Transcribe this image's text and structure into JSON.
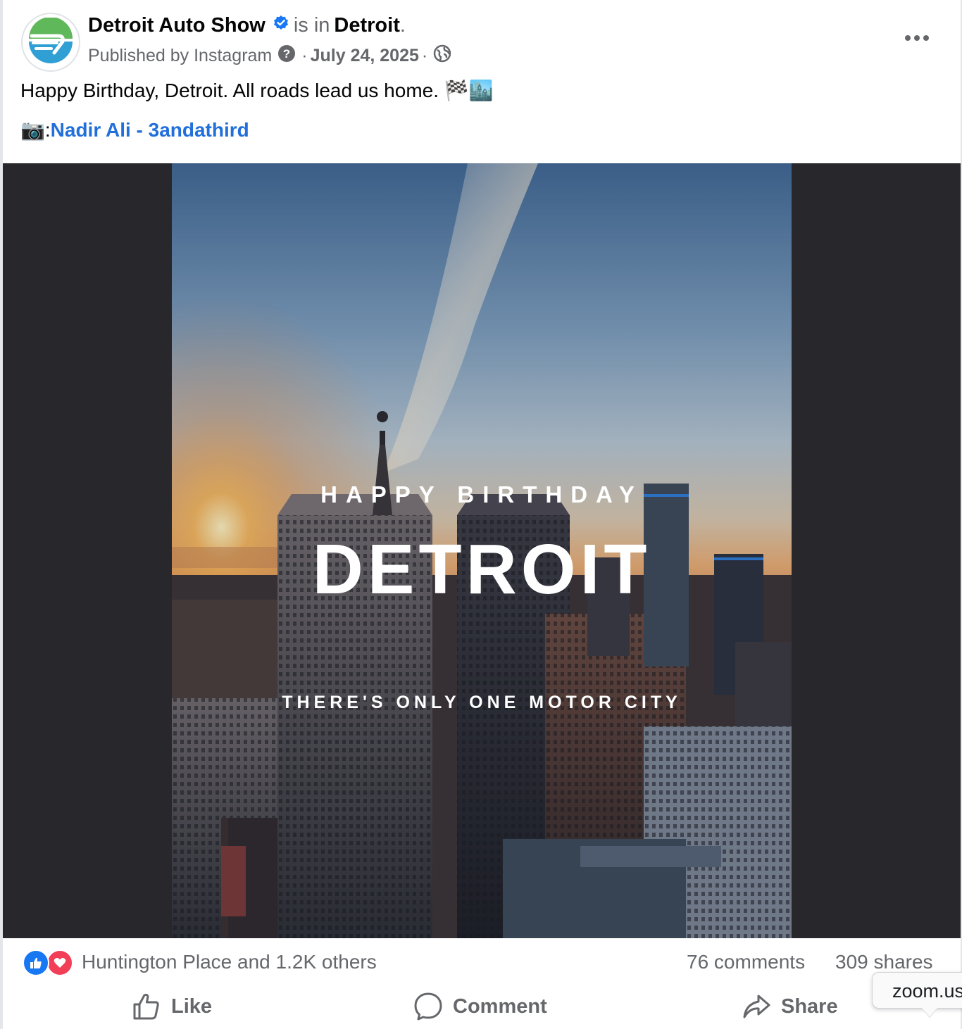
{
  "post": {
    "author": "Detroit Auto Show",
    "is_in": "is in",
    "location": "Detroit",
    "location_suffix": ".",
    "published_by": "Published by Instagram",
    "date": "July 24, 2025",
    "separator": "·",
    "caption": "Happy Birthday, Detroit. All roads lead us home. 🏁🏙️",
    "credit_prefix": "📷: ",
    "credit_link": "Nadir Ali - 3andathird",
    "icons": {
      "avatar": "detroit-auto-show-logo",
      "verified": "verified-badge-icon",
      "help": "question-icon",
      "audience": "globe-icon",
      "more": "more-options-icon"
    }
  },
  "image": {
    "line1": "HAPPY BIRTHDAY",
    "line2": "DETROIT",
    "line3": "THERE'S ONLY ONE MOTOR CITY"
  },
  "stats": {
    "reactions_text": "Huntington Place and 1.2K others",
    "comments": "76 comments",
    "shares": "309 shares"
  },
  "actions": {
    "like": "Like",
    "comment": "Comment",
    "share": "Share"
  },
  "tooltip": {
    "text": "zoom.us"
  },
  "colors": {
    "link_blue": "#216fdb",
    "verified_blue": "#1877f2",
    "muted_gray": "#65676b",
    "media_bg": "#28272c",
    "love_red": "#f33e58"
  }
}
